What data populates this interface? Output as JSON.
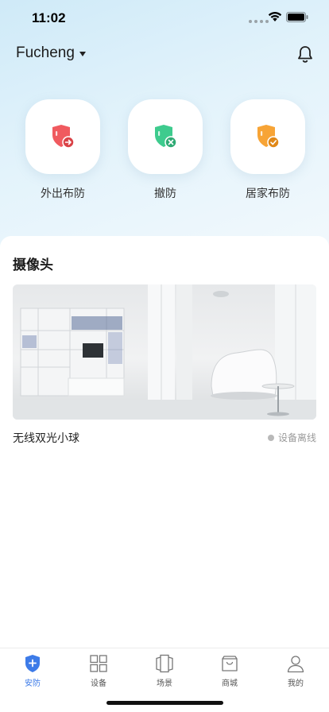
{
  "status_bar": {
    "time": "11:02"
  },
  "header": {
    "location": "Fucheng"
  },
  "modes": [
    {
      "label": "外出布防",
      "icon": "shield-arrow-icon",
      "color": "#f05a5f"
    },
    {
      "label": "撤防",
      "icon": "shield-x-icon",
      "color": "#3ecb8e"
    },
    {
      "label": "居家布防",
      "icon": "shield-check-icon",
      "color": "#f7a436"
    }
  ],
  "camera_section": {
    "title": "摄像头",
    "device_name": "无线双光小球",
    "device_status": "设备离线"
  },
  "tabbar": {
    "items": [
      {
        "label": "安防",
        "icon": "shield-plus-icon",
        "active": true
      },
      {
        "label": "设备",
        "icon": "grid-icon",
        "active": false
      },
      {
        "label": "场景",
        "icon": "scene-icon",
        "active": false
      },
      {
        "label": "商城",
        "icon": "shopping-bag-icon",
        "active": false
      },
      {
        "label": "我的",
        "icon": "person-icon",
        "active": false
      }
    ],
    "accent_color": "#3d7be8"
  }
}
